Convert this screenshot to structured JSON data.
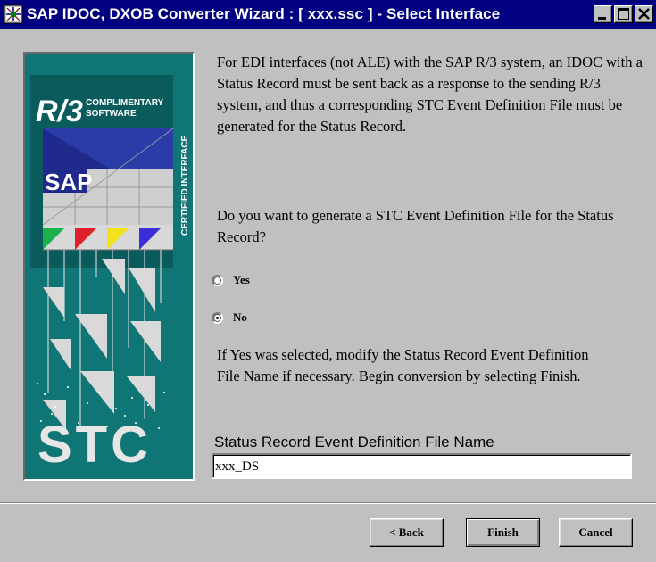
{
  "window": {
    "title": "SAP IDOC, DXOB Converter Wizard : [ xxx.ssc ] - Select Interface"
  },
  "banner": {
    "r3_text": "R/3",
    "complimentary_text": "COMPLIMENTARY",
    "software_text": "SOFTWARE",
    "certified_text": "CERTIFIED INTERFACE",
    "sap_text": "SAP",
    "stc_text": "STC"
  },
  "content": {
    "paragraph1": "For EDI interfaces (not ALE) with the SAP R/3 system, an IDOC with a Status Record must be sent back as a response to the sending R/3 system, and thus a corresponding STC Event Definition File must be generated for the Status Record.",
    "question": "Do you want to generate a STC Event Definition File for the Status Record?",
    "options": [
      {
        "label": "Yes",
        "selected": false
      },
      {
        "label": "No",
        "selected": true
      }
    ],
    "instruction": "If Yes was selected, modify the Status Record Event Definition File Name if necessary.  Begin conversion by selecting Finish.",
    "field_label": "Status Record Event Definition File Name",
    "field_value": "xxx_DS"
  },
  "buttons": {
    "back": "< Back",
    "finish": "Finish",
    "cancel": "Cancel"
  }
}
